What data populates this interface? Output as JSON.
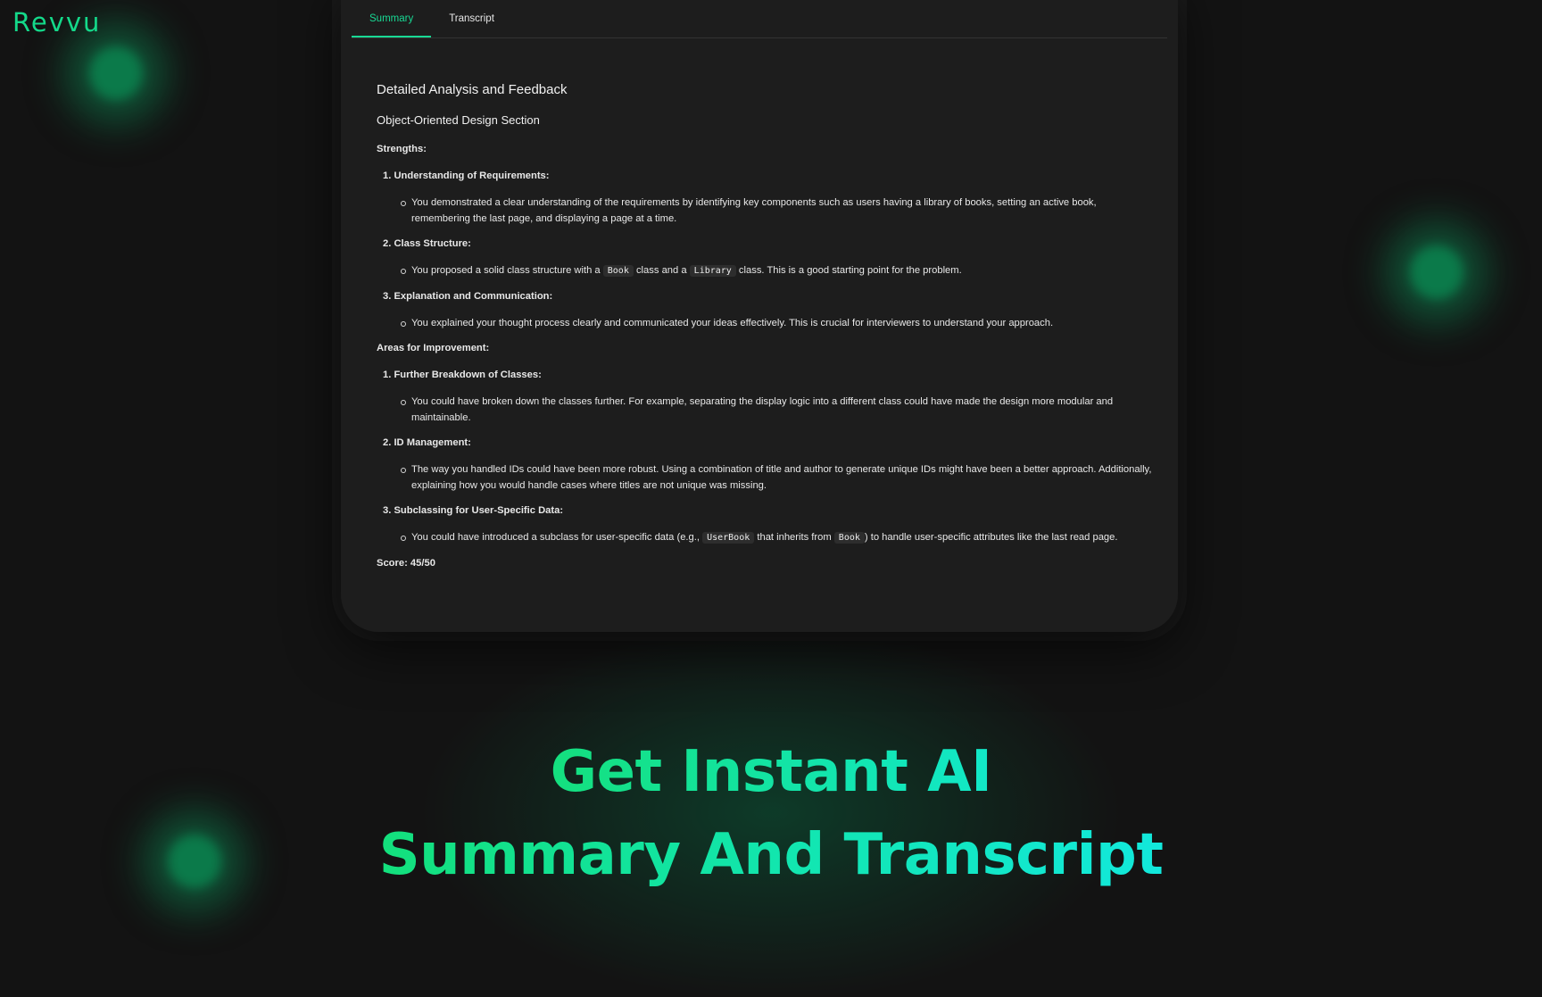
{
  "brand": {
    "logo": "Revvu"
  },
  "tabs": [
    {
      "label": "Summary",
      "active": true
    },
    {
      "label": "Transcript",
      "active": false
    }
  ],
  "summary": {
    "title": "Detailed Analysis and Feedback",
    "section": "Object-Oriented Design Section",
    "strengths_heading": "Strengths:",
    "strengths": [
      {
        "number": "1.",
        "title": "Understanding of Requirements:",
        "detail": "You demonstrated a clear understanding of the requirements by identifying key components such as users having a library of books, setting an active book, remembering the last page, and displaying a page at a time."
      },
      {
        "number": "2.",
        "title": "Class Structure:",
        "detail_parts": [
          "You proposed a solid class structure with a ",
          "Book",
          " class and a ",
          "Library",
          " class. This is a good starting point for the problem."
        ]
      },
      {
        "number": "3.",
        "title": "Explanation and Communication:",
        "detail": "You explained your thought process clearly and communicated your ideas effectively. This is crucial for interviewers to understand your approach."
      }
    ],
    "improvements_heading": "Areas for Improvement:",
    "improvements": [
      {
        "number": "1.",
        "title": "Further Breakdown of Classes:",
        "detail": "You could have broken down the classes further. For example, separating the display logic into a different class could have made the design more modular and maintainable."
      },
      {
        "number": "2.",
        "title": "ID Management:",
        "detail": "The way you handled IDs could have been more robust. Using a combination of title and author to generate unique IDs might have been a better approach. Additionally, explaining how you would handle cases where titles are not unique was missing."
      },
      {
        "number": "3.",
        "title": "Subclassing for User-Specific Data:",
        "detail_parts": [
          "You could have introduced a subclass for user-specific data (e.g., ",
          "UserBook",
          " that inherits from ",
          "Book",
          ") to handle user-specific attributes like the last read page."
        ]
      }
    ],
    "score": "Score: 45/50"
  },
  "headline": {
    "line1": "Get Instant AI",
    "line2": "Summary And Transcript"
  },
  "colors": {
    "accent": "#18d994",
    "background": "#131313",
    "card": "#1d1d1d"
  }
}
